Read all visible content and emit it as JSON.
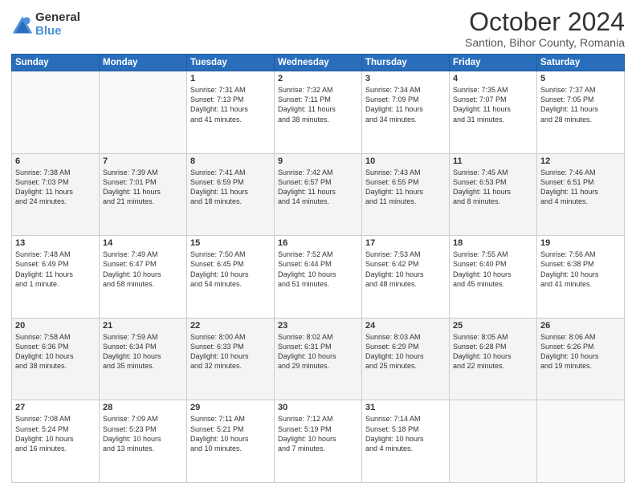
{
  "logo": {
    "general": "General",
    "blue": "Blue"
  },
  "title": "October 2024",
  "subtitle": "Santion, Bihor County, Romania",
  "weekdays": [
    "Sunday",
    "Monday",
    "Tuesday",
    "Wednesday",
    "Thursday",
    "Friday",
    "Saturday"
  ],
  "weeks": [
    [
      {
        "day": "",
        "info": ""
      },
      {
        "day": "",
        "info": ""
      },
      {
        "day": "1",
        "info": "Sunrise: 7:31 AM\nSunset: 7:13 PM\nDaylight: 11 hours\nand 41 minutes."
      },
      {
        "day": "2",
        "info": "Sunrise: 7:32 AM\nSunset: 7:11 PM\nDaylight: 11 hours\nand 38 minutes."
      },
      {
        "day": "3",
        "info": "Sunrise: 7:34 AM\nSunset: 7:09 PM\nDaylight: 11 hours\nand 34 minutes."
      },
      {
        "day": "4",
        "info": "Sunrise: 7:35 AM\nSunset: 7:07 PM\nDaylight: 11 hours\nand 31 minutes."
      },
      {
        "day": "5",
        "info": "Sunrise: 7:37 AM\nSunset: 7:05 PM\nDaylight: 11 hours\nand 28 minutes."
      }
    ],
    [
      {
        "day": "6",
        "info": "Sunrise: 7:38 AM\nSunset: 7:03 PM\nDaylight: 11 hours\nand 24 minutes."
      },
      {
        "day": "7",
        "info": "Sunrise: 7:39 AM\nSunset: 7:01 PM\nDaylight: 11 hours\nand 21 minutes."
      },
      {
        "day": "8",
        "info": "Sunrise: 7:41 AM\nSunset: 6:59 PM\nDaylight: 11 hours\nand 18 minutes."
      },
      {
        "day": "9",
        "info": "Sunrise: 7:42 AM\nSunset: 6:57 PM\nDaylight: 11 hours\nand 14 minutes."
      },
      {
        "day": "10",
        "info": "Sunrise: 7:43 AM\nSunset: 6:55 PM\nDaylight: 11 hours\nand 11 minutes."
      },
      {
        "day": "11",
        "info": "Sunrise: 7:45 AM\nSunset: 6:53 PM\nDaylight: 11 hours\nand 8 minutes."
      },
      {
        "day": "12",
        "info": "Sunrise: 7:46 AM\nSunset: 6:51 PM\nDaylight: 11 hours\nand 4 minutes."
      }
    ],
    [
      {
        "day": "13",
        "info": "Sunrise: 7:48 AM\nSunset: 6:49 PM\nDaylight: 11 hours\nand 1 minute."
      },
      {
        "day": "14",
        "info": "Sunrise: 7:49 AM\nSunset: 6:47 PM\nDaylight: 10 hours\nand 58 minutes."
      },
      {
        "day": "15",
        "info": "Sunrise: 7:50 AM\nSunset: 6:45 PM\nDaylight: 10 hours\nand 54 minutes."
      },
      {
        "day": "16",
        "info": "Sunrise: 7:52 AM\nSunset: 6:44 PM\nDaylight: 10 hours\nand 51 minutes."
      },
      {
        "day": "17",
        "info": "Sunrise: 7:53 AM\nSunset: 6:42 PM\nDaylight: 10 hours\nand 48 minutes."
      },
      {
        "day": "18",
        "info": "Sunrise: 7:55 AM\nSunset: 6:40 PM\nDaylight: 10 hours\nand 45 minutes."
      },
      {
        "day": "19",
        "info": "Sunrise: 7:56 AM\nSunset: 6:38 PM\nDaylight: 10 hours\nand 41 minutes."
      }
    ],
    [
      {
        "day": "20",
        "info": "Sunrise: 7:58 AM\nSunset: 6:36 PM\nDaylight: 10 hours\nand 38 minutes."
      },
      {
        "day": "21",
        "info": "Sunrise: 7:59 AM\nSunset: 6:34 PM\nDaylight: 10 hours\nand 35 minutes."
      },
      {
        "day": "22",
        "info": "Sunrise: 8:00 AM\nSunset: 6:33 PM\nDaylight: 10 hours\nand 32 minutes."
      },
      {
        "day": "23",
        "info": "Sunrise: 8:02 AM\nSunset: 6:31 PM\nDaylight: 10 hours\nand 29 minutes."
      },
      {
        "day": "24",
        "info": "Sunrise: 8:03 AM\nSunset: 6:29 PM\nDaylight: 10 hours\nand 25 minutes."
      },
      {
        "day": "25",
        "info": "Sunrise: 8:05 AM\nSunset: 6:28 PM\nDaylight: 10 hours\nand 22 minutes."
      },
      {
        "day": "26",
        "info": "Sunrise: 8:06 AM\nSunset: 6:26 PM\nDaylight: 10 hours\nand 19 minutes."
      }
    ],
    [
      {
        "day": "27",
        "info": "Sunrise: 7:08 AM\nSunset: 5:24 PM\nDaylight: 10 hours\nand 16 minutes."
      },
      {
        "day": "28",
        "info": "Sunrise: 7:09 AM\nSunset: 5:23 PM\nDaylight: 10 hours\nand 13 minutes."
      },
      {
        "day": "29",
        "info": "Sunrise: 7:11 AM\nSunset: 5:21 PM\nDaylight: 10 hours\nand 10 minutes."
      },
      {
        "day": "30",
        "info": "Sunrise: 7:12 AM\nSunset: 5:19 PM\nDaylight: 10 hours\nand 7 minutes."
      },
      {
        "day": "31",
        "info": "Sunrise: 7:14 AM\nSunset: 5:18 PM\nDaylight: 10 hours\nand 4 minutes."
      },
      {
        "day": "",
        "info": ""
      },
      {
        "day": "",
        "info": ""
      }
    ]
  ]
}
